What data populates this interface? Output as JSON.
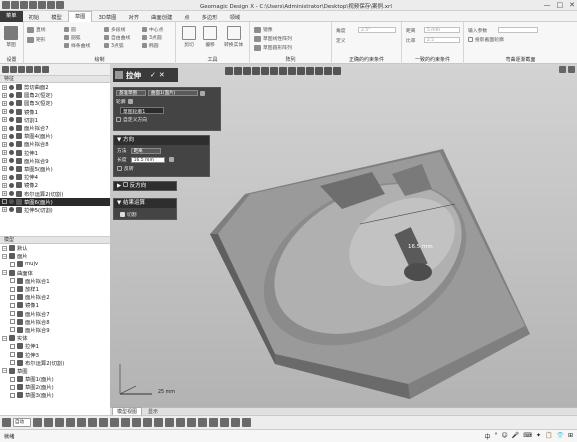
{
  "window": {
    "title": "Geomagic Design X - C:\\Users\\Administrator\\Desktop\\视频保存\\案例.xrl",
    "controls": [
      "—",
      "□",
      "✕"
    ]
  },
  "menu": {
    "items": [
      "菜单",
      "初始",
      "模型",
      "草图",
      "3D草图",
      "对齐",
      "曲面创建",
      "点",
      "多边形",
      "领域"
    ],
    "active": "草图"
  },
  "ribbon": {
    "groups": [
      {
        "label": "设置",
        "buttons": [
          "草图"
        ]
      },
      {
        "label": "绘制",
        "buttons": [
          "直线",
          "矩形",
          "圆",
          "圆弧",
          "样条曲线",
          "多段线",
          "自由曲线",
          "3点弧",
          "中心点",
          "3点圆",
          "椭圆",
          "倒角"
        ]
      },
      {
        "label": "工具",
        "buttons": [
          "剪切",
          "偏移",
          "转换实体"
        ]
      },
      {
        "label": "阵列",
        "buttons": [
          "镜像",
          "草图线性阵列",
          "草图圆形阵列"
        ]
      },
      {
        "label": "正确的约束条件",
        "buttons": [
          "角度",
          "定义"
        ]
      },
      {
        "label": "一致的约束条件",
        "buttons": [
          "调整"
        ]
      },
      {
        "label": "弯曲逐渐截面",
        "buttons": [
          "输入参数",
          "投影截面轮廓"
        ]
      }
    ],
    "constraint_fields": {
      "angle_label": "角度",
      "angle_value": "2.5°",
      "dist_label": "距离",
      "dist_value": "5 mm",
      "ratio_label": "比率",
      "ratio_value": "2.5"
    }
  },
  "feature_tree": {
    "header": "特征",
    "items": [
      {
        "label": "剪切曲面2",
        "selected": false
      },
      {
        "label": "圆角2(恒定)",
        "selected": false
      },
      {
        "label": "圆角3(恒定)",
        "selected": false
      },
      {
        "label": "镜像1",
        "selected": false
      },
      {
        "label": "切割1",
        "selected": false
      },
      {
        "label": "面片拟合7",
        "selected": false
      },
      {
        "label": "草图4(面片)",
        "selected": false
      },
      {
        "label": "面片拟合8",
        "selected": false
      },
      {
        "label": "拉伸1",
        "selected": false
      },
      {
        "label": "面片拟合9",
        "selected": false
      },
      {
        "label": "草图5(面片)",
        "selected": false
      },
      {
        "label": "拉伸4",
        "selected": false
      },
      {
        "label": "镜像2",
        "selected": false
      },
      {
        "label": "布尔运算2(切割)",
        "selected": false
      },
      {
        "label": "草图6(面片)",
        "selected": true
      },
      {
        "label": "拉伸5(切割)",
        "selected": false
      }
    ]
  },
  "model_tree": {
    "header": "模型",
    "items": [
      {
        "label": "默认",
        "level": 0
      },
      {
        "label": "面片",
        "level": 0
      },
      {
        "label": "mujv",
        "level": 1
      },
      {
        "label": "曲面体",
        "level": 0
      },
      {
        "label": "面片拟合1",
        "level": 1
      },
      {
        "label": "放样1",
        "level": 1
      },
      {
        "label": "面片拟合2",
        "level": 1
      },
      {
        "label": "镜像1",
        "level": 1
      },
      {
        "label": "面片拟合7",
        "level": 1
      },
      {
        "label": "面片拟合8",
        "level": 1
      },
      {
        "label": "面片拟合9",
        "level": 1
      },
      {
        "label": "实体",
        "level": 0
      },
      {
        "label": "拉伸1",
        "level": 1
      },
      {
        "label": "拉伸3",
        "level": 1
      },
      {
        "label": "布尔运算2(切割)",
        "level": 1
      },
      {
        "label": "草图",
        "level": 0
      },
      {
        "label": "草图1(面片)",
        "level": 1
      },
      {
        "label": "草图2(面片)",
        "level": 1
      },
      {
        "label": "草图3(面片)",
        "level": 1
      }
    ]
  },
  "extrude_dialog": {
    "title": "拉伸",
    "ok": "✓",
    "cancel": "✕",
    "base_sketch_label": "基准草图",
    "base_sketch_value": "曲面1(面片)",
    "profile_label": "轮廓",
    "profile_item": "草图轮廓1",
    "auto_direction": "自定义方向",
    "direction_header": "方向",
    "method_label": "方法",
    "method_value": "距离",
    "length_label": "长度",
    "length_value": "16.5 mm",
    "reverse_label": "反转",
    "reverse_direction_header": "反方向",
    "result_header": "结果运算",
    "cut_label": "切割"
  },
  "viewport": {
    "dimension_label": "16.5 mm",
    "scale_label": "25 mm"
  },
  "bottom_tabs": {
    "items": [
      "模型视图",
      "显示"
    ],
    "active": "模型视图"
  },
  "statusbar": {
    "ready": "就绪",
    "select_mode": "自动",
    "ime": [
      "中",
      "°",
      "☺",
      "🎤",
      "⌨",
      "✦",
      "📋",
      "👕",
      "⊞"
    ]
  }
}
